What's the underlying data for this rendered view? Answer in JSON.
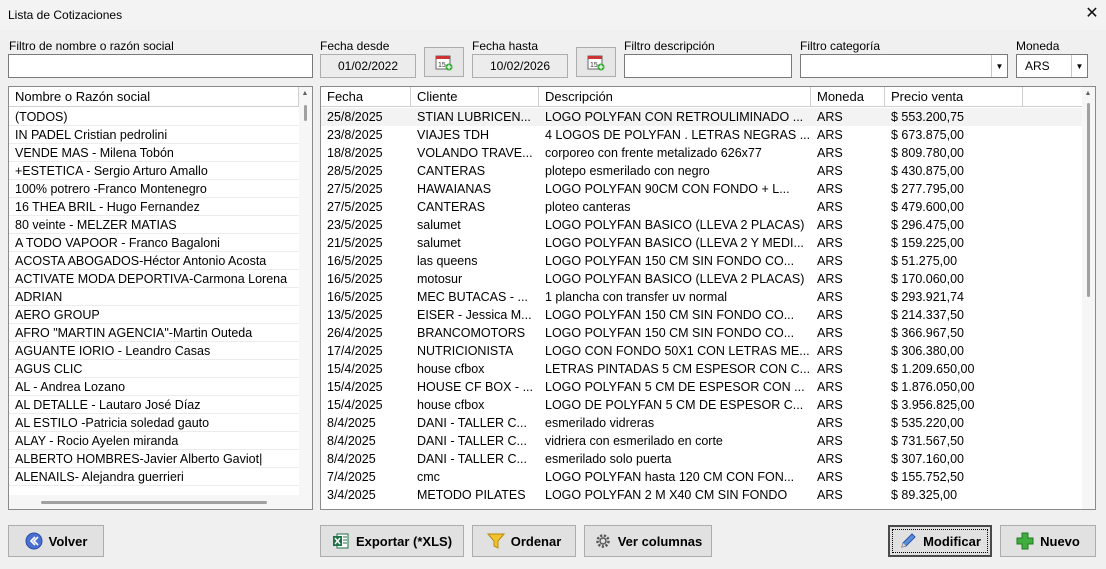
{
  "window": {
    "title": "Lista de Cotizaciones",
    "close": "✕"
  },
  "filters": {
    "name_label": "Filtro de nombre o razón social",
    "name_value": "",
    "date_from_label": "Fecha desde",
    "date_from_value": "01/02/2022",
    "date_to_label": "Fecha hasta",
    "date_to_value": "10/02/2026",
    "desc_label": "Filtro descripción",
    "desc_value": "",
    "cat_label": "Filtro categoría",
    "cat_value": "",
    "currency_label": "Moneda",
    "currency_value": "ARS"
  },
  "client_list": {
    "header": "Nombre o Razón social",
    "items": [
      "(TODOS)",
      " IN PADEL Cristian pedrolini",
      " VENDE MAS - Milena Tobón",
      "+ESTETICA - Sergio Arturo Amallo",
      "100% potrero -Franco Montenegro",
      "16 THEA BRIL - Hugo Fernandez",
      "80 veinte - MELZER MATIAS",
      "A TODO VAPOOR - Franco Bagaloni",
      "ACOSTA ABOGADOS-Héctor Antonio Acosta",
      "ACTIVATE MODA DEPORTIVA-Carmona Lorena",
      "ADRIAN",
      "AERO GROUP",
      "AFRO \"MARTIN AGENCIA\"-Martin Outeda",
      "AGUANTE IORIO - Leandro Casas",
      "AGUS CLIC",
      "AL - Andrea Lozano",
      "AL DETALLE  - Lautaro José Díaz",
      "AL ESTILO -Patricia soledad gauto",
      "ALAY - Rocio Ayelen miranda",
      "ALBERTO HOMBRES-Javier Alberto Gaviot|",
      "ALENAILS- Alejandra guerrieri"
    ]
  },
  "quotes": {
    "columns": [
      "Fecha",
      "Cliente",
      "Descripción",
      "Moneda",
      "Precio venta"
    ],
    "rows": [
      [
        "25/8/2025",
        "STIAN LUBRICEN...",
        "LOGO POLYFAN CON RETROULIMINADO ...",
        "ARS",
        "$ 553.200,75"
      ],
      [
        "23/8/2025",
        "VIAJES TDH",
        "4 LOGOS DE POLYFAN . LETRAS NEGRAS ...",
        "ARS",
        "$ 673.875,00"
      ],
      [
        "18/8/2025",
        "VOLANDO TRAVE...",
        "corporeo con frente metalizado  626x77",
        "ARS",
        "$ 809.780,00"
      ],
      [
        "28/5/2025",
        "CANTERAS",
        "plotepo esmerilado con negro",
        "ARS",
        "$ 430.875,00"
      ],
      [
        "27/5/2025",
        "HAWAIANAS",
        "LOGO POLYFAN  90CM CON FONDO + L...",
        "ARS",
        "$ 277.795,00"
      ],
      [
        "27/5/2025",
        "CANTERAS",
        "ploteo canteras",
        "ARS",
        "$ 479.600,00"
      ],
      [
        "23/5/2025",
        "salumet",
        "LOGO POLYFAN BASICO (LLEVA 2 PLACAS)",
        "ARS",
        "$ 296.475,00"
      ],
      [
        "21/5/2025",
        "salumet",
        "LOGO POLYFAN BASICO (LLEVA 2 Y MEDI...",
        "ARS",
        "$ 159.225,00"
      ],
      [
        "16/5/2025",
        "las queens",
        "LOGO POLYFAN  150 CM SIN FONDO CO...",
        "ARS",
        "$ 51.275,00"
      ],
      [
        "16/5/2025",
        "motosur",
        "LOGO POLYFAN BASICO (LLEVA 2 PLACAS)",
        "ARS",
        "$ 170.060,00"
      ],
      [
        "16/5/2025",
        "MEC BUTACAS - ...",
        "1 plancha con transfer uv normal",
        "ARS",
        "$ 293.921,74"
      ],
      [
        "13/5/2025",
        "EISER - Jessica M...",
        "LOGO POLYFAN  150 CM SIN FONDO CO...",
        "ARS",
        "$ 214.337,50"
      ],
      [
        "26/4/2025",
        "BRANCOMOTORS",
        "LOGO POLYFAN  150 CM SIN FONDO CO...",
        "ARS",
        "$ 366.967,50"
      ],
      [
        "17/4/2025",
        "NUTRICIONISTA",
        "LOGO CON FONDO 50X1 CON LETRAS ME...",
        "ARS",
        "$ 306.380,00"
      ],
      [
        "15/4/2025",
        "house cfbox",
        "LETRAS PINTADAS 5 CM ESPESOR CON C...",
        "ARS",
        "$ 1.209.650,00"
      ],
      [
        "15/4/2025",
        "HOUSE CF BOX - ...",
        "LOGO POLYFAN 5 CM DE ESPESOR CON ...",
        "ARS",
        "$ 1.876.050,00"
      ],
      [
        "15/4/2025",
        "house cfbox",
        "LOGO DE POLYFAN 5 CM DE ESPESOR C...",
        "ARS",
        "$ 3.956.825,00"
      ],
      [
        "8/4/2025",
        "DANI - TALLER C...",
        "esmerilado vidreras",
        "ARS",
        "$ 535.220,00"
      ],
      [
        "8/4/2025",
        "DANI - TALLER C...",
        "vidriera con esmerilado en corte",
        "ARS",
        "$ 731.567,50"
      ],
      [
        "8/4/2025",
        "DANI - TALLER C...",
        "esmerilado solo puerta",
        "ARS",
        "$ 307.160,00"
      ],
      [
        "7/4/2025",
        "cmc",
        "LOGO POLYFAN  hasta 120 CM CON FON...",
        "ARS",
        "$ 155.752,50"
      ],
      [
        "3/4/2025",
        "METODO PILATES",
        "LOGO POLYFAN  2 M X40 CM SIN FONDO",
        "ARS",
        "$ 89.325,00"
      ]
    ]
  },
  "buttons": {
    "back": "Volver",
    "export": "Exportar (*XLS)",
    "sort": "Ordenar",
    "columns": "Ver columnas",
    "modify": "Modificar",
    "new": "Nuevo"
  }
}
